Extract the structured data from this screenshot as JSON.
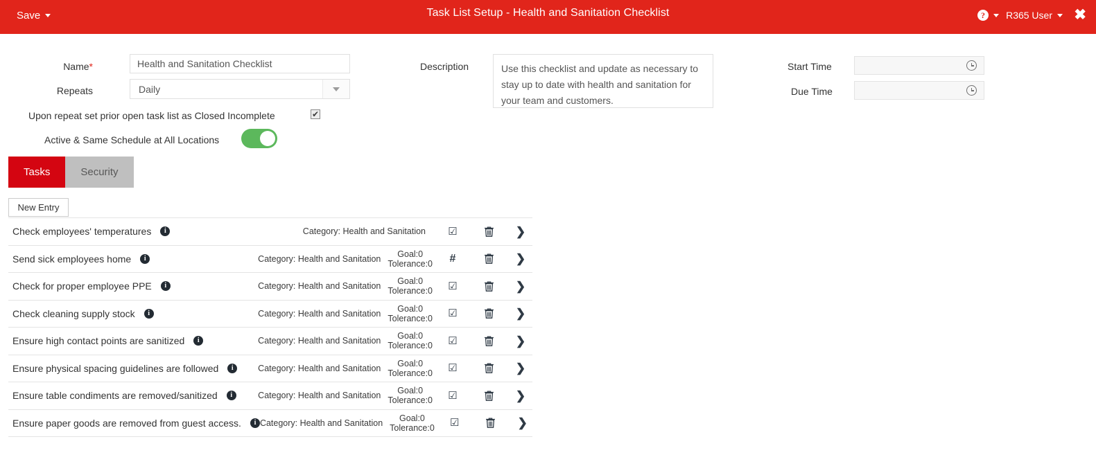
{
  "header": {
    "save_label": "Save",
    "title": "Task List Setup - Health and Sanitation Checklist",
    "help_glyph": "?",
    "user_label": "R365 User",
    "close_glyph": "✖",
    "background_color": "#e1251b"
  },
  "form": {
    "name_label": "Name",
    "name_required_marker": "*",
    "name_value": "Health and Sanitation Checklist",
    "repeats_label": "Repeats",
    "repeats_value": "Daily",
    "repeats_options": [
      "Daily"
    ],
    "repeat_close_label": "Upon repeat set prior open task list as Closed Incomplete",
    "repeat_close_checked_glyph": "✔",
    "active_label": "Active & Same Schedule at All Locations",
    "active_toggle_on": true,
    "toggle_color": "#5cb85c",
    "description_label": "Description",
    "description_value": "Use this checklist and update as necessary to stay up to date with health and sanitation for your team and customers.",
    "start_time_label": "Start Time",
    "start_time_value": "",
    "due_time_label": "Due Time",
    "due_time_value": "",
    "clock_icon": "clock-icon"
  },
  "tabs": [
    {
      "label": "Tasks",
      "active": true
    },
    {
      "label": "Security",
      "active": false
    }
  ],
  "toolbar": {
    "new_entry_label": "New Entry"
  },
  "tasks": {
    "checkbox_glyph": "☑",
    "hash_glyph": "#",
    "trash_icon": "trash-icon",
    "chevron_glyph": "❯",
    "info_glyph": "i",
    "rows": [
      {
        "name": "Check employees' temperatures",
        "category": "Category: Health and Sanitation",
        "goal": "",
        "tolerance": "",
        "type": "checkbox"
      },
      {
        "name": "Send sick employees home",
        "category": "Category: Health and Sanitation",
        "goal": "Goal:0",
        "tolerance": "Tolerance:0",
        "type": "number"
      },
      {
        "name": "Check for proper employee PPE",
        "category": "Category: Health and Sanitation",
        "goal": "Goal:0",
        "tolerance": "Tolerance:0",
        "type": "checkbox"
      },
      {
        "name": "Check cleaning supply stock",
        "category": "Category: Health and Sanitation",
        "goal": "Goal:0",
        "tolerance": "Tolerance:0",
        "type": "checkbox"
      },
      {
        "name": "Ensure high contact points are sanitized",
        "category": "Category: Health and Sanitation",
        "goal": "Goal:0",
        "tolerance": "Tolerance:0",
        "type": "checkbox"
      },
      {
        "name": "Ensure physical spacing guidelines are followed",
        "category": "Category: Health and Sanitation",
        "goal": "Goal:0",
        "tolerance": "Tolerance:0",
        "type": "checkbox"
      },
      {
        "name": "Ensure table condiments are removed/sanitized",
        "category": "Category: Health and Sanitation",
        "goal": "Goal:0",
        "tolerance": "Tolerance:0",
        "type": "checkbox"
      },
      {
        "name": "Ensure paper goods are removed from guest access.",
        "category": "Category: Health and Sanitation",
        "goal": "Goal:0",
        "tolerance": "Tolerance:0",
        "type": "checkbox"
      }
    ]
  }
}
